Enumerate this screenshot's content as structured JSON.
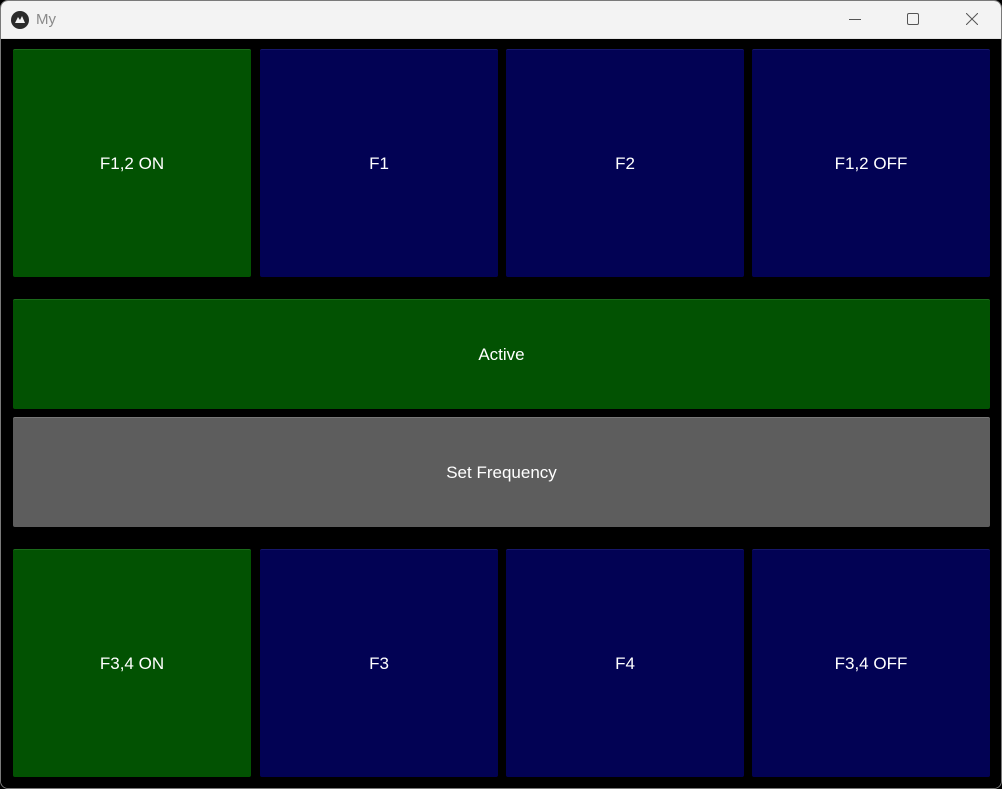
{
  "window": {
    "title": "My"
  },
  "colors": {
    "green": "#025202",
    "navy": "#020254",
    "gray": "#5d5d5d",
    "background": "#000000"
  },
  "top_row": [
    {
      "label": "F1,2 ON",
      "color": "green"
    },
    {
      "label": "F1",
      "color": "navy"
    },
    {
      "label": "F2",
      "color": "navy"
    },
    {
      "label": "F1,2 OFF",
      "color": "navy"
    }
  ],
  "status": {
    "label": "Active",
    "color": "green"
  },
  "set_frequency": {
    "label": "Set Frequency",
    "color": "gray"
  },
  "bottom_row": [
    {
      "label": "F3,4 ON",
      "color": "green"
    },
    {
      "label": "F3",
      "color": "navy"
    },
    {
      "label": "F4",
      "color": "navy"
    },
    {
      "label": "F3,4 OFF",
      "color": "navy"
    }
  ]
}
